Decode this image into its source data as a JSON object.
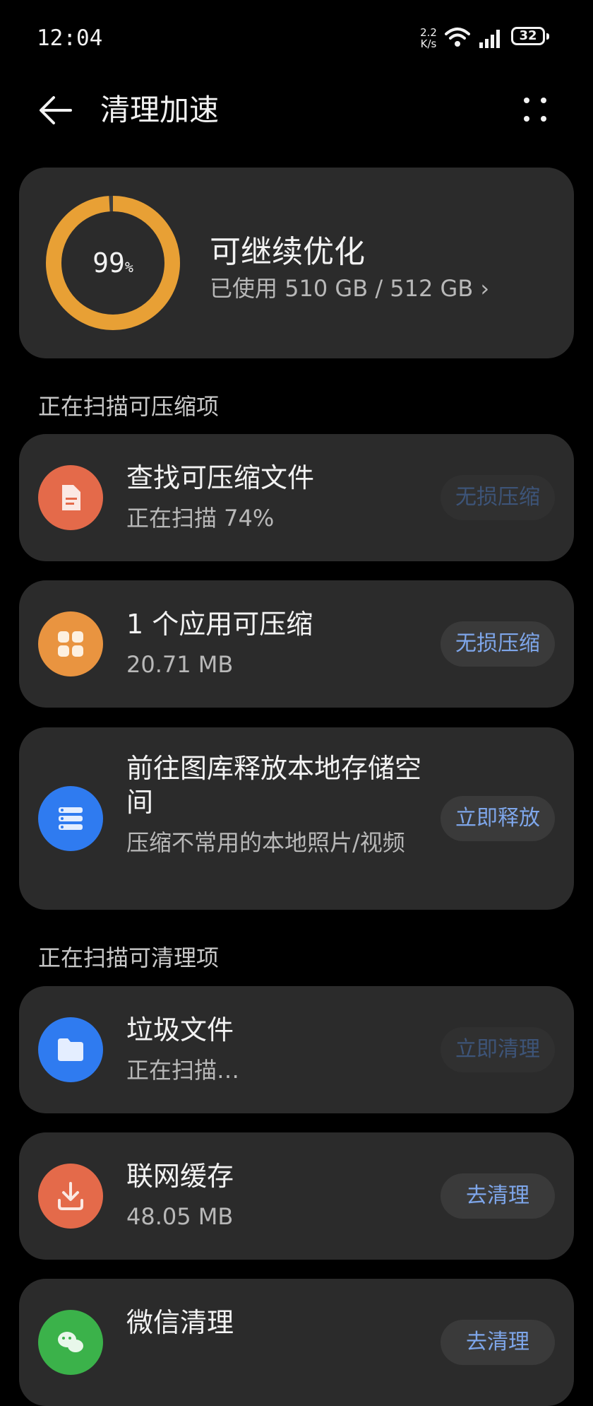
{
  "status_bar": {
    "time": "12:04",
    "net_speed_value": "2.2",
    "net_speed_unit": "K/s",
    "battery_level": "32",
    "icons": [
      "wifi-icon",
      "signal-icon",
      "battery-icon"
    ]
  },
  "header": {
    "title": "清理加速",
    "back_icon": "back-arrow-icon",
    "more_icon": "more-dots-icon"
  },
  "storage": {
    "percent": "99",
    "percent_unit": "%",
    "percent_value": 0.99,
    "title": "可继续优化",
    "used": "已使用 510 GB / 512 GB",
    "chevron": "›",
    "ring_color": "#e8a035"
  },
  "sections": {
    "compress_header": "正在扫描可压缩项",
    "clean_header": "正在扫描可清理项"
  },
  "compress_items": [
    {
      "title": "查找可压缩文件",
      "subtitle": "正在扫描 74%",
      "button": "无损压缩",
      "icon": "document-icon",
      "color": "#e46a4a",
      "button_enabled": false
    },
    {
      "title": "1 个应用可压缩",
      "subtitle": "20.71 MB",
      "button": "无损压缩",
      "icon": "apps-grid-icon",
      "color": "#e99440",
      "button_enabled": true
    },
    {
      "title": "前往图库释放本地存储空间",
      "subtitle": "压缩不常用的本地照片/视频",
      "button": "立即释放",
      "icon": "storage-stack-icon",
      "color": "#2f7bf0",
      "button_enabled": true
    }
  ],
  "clean_items": [
    {
      "title": "垃圾文件",
      "subtitle": "正在扫描…",
      "button": "立即清理",
      "icon": "folder-icon",
      "color": "#2f7bf0",
      "button_enabled": false
    },
    {
      "title": "联网缓存",
      "subtitle": "48.05 MB",
      "button": "去清理",
      "icon": "download-icon",
      "color": "#e46a4a",
      "button_enabled": true
    },
    {
      "title": "微信清理",
      "subtitle": "",
      "button": "去清理",
      "icon": "wechat-icon",
      "color": "#3bb24a",
      "button_enabled": true
    }
  ]
}
